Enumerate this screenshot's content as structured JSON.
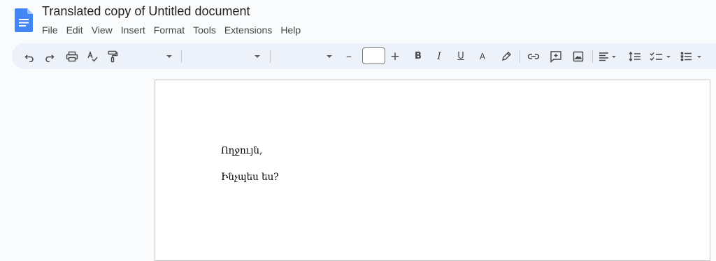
{
  "document": {
    "title": "Translated copy of Untitled document",
    "paragraphs": [
      "Ողջույն,",
      "Ինչպես ես?"
    ]
  },
  "menu": [
    "File",
    "Edit",
    "View",
    "Insert",
    "Format",
    "Tools",
    "Extensions",
    "Help"
  ],
  "toolbar": {
    "decrease_font": "–",
    "increase_font": "+",
    "bold": "B",
    "italic": "I",
    "underline": "U",
    "text_color": "A",
    "font_size_value": ""
  },
  "colors": {
    "app_icon": "#4285f4",
    "toolbar_bg": "#edf2fa",
    "page_bg": "#ffffff",
    "canvas_bg": "#f9fbfd"
  },
  "icons": [
    "docs-logo-icon",
    "undo-icon",
    "redo-icon",
    "print-icon",
    "spellcheck-icon",
    "paint-format-icon",
    "link-icon",
    "add-comment-icon",
    "insert-image-icon",
    "align-icon",
    "line-spacing-icon",
    "checklist-icon",
    "bulleted-list-icon"
  ]
}
